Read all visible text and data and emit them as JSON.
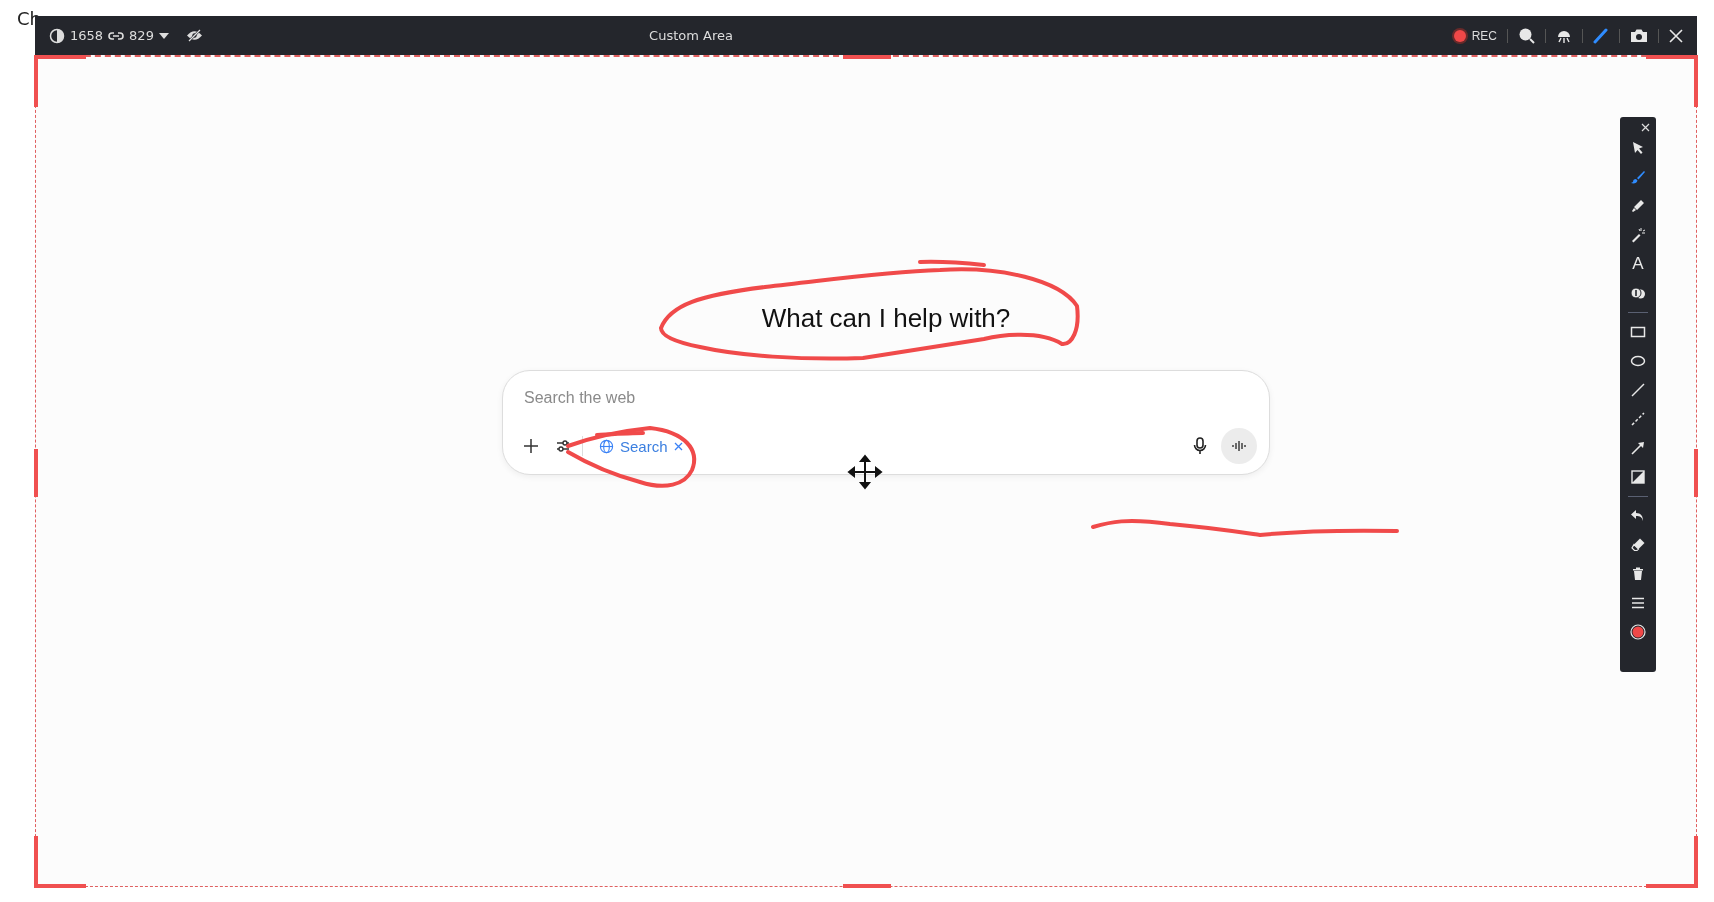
{
  "background_title": "Ch",
  "capture_bar": {
    "width_value": "1658",
    "height_value": "829",
    "title": "Custom Area",
    "rec_label": "REC",
    "tools": [
      {
        "kind": "magnifier",
        "selected": false
      },
      {
        "kind": "spotlight",
        "selected": false
      },
      {
        "kind": "pen",
        "selected": true
      },
      {
        "kind": "camera",
        "selected": false
      },
      {
        "kind": "close",
        "selected": false
      }
    ]
  },
  "heading": "What can I help with?",
  "composer": {
    "placeholder": "Search the web",
    "chip_label": "Search"
  },
  "side_toolbar": [
    {
      "kind": "pointer",
      "selected": false
    },
    {
      "kind": "brush",
      "selected": true
    },
    {
      "kind": "marker",
      "selected": false
    },
    {
      "kind": "magic",
      "selected": false
    },
    {
      "kind": "text",
      "label": "A",
      "selected": false
    },
    {
      "kind": "counter",
      "selected": false
    },
    {
      "kind": "divider"
    },
    {
      "kind": "rectangle",
      "selected": false
    },
    {
      "kind": "ellipse",
      "selected": false
    },
    {
      "kind": "line",
      "selected": false
    },
    {
      "kind": "dashed-line",
      "selected": false
    },
    {
      "kind": "arrow",
      "selected": false
    },
    {
      "kind": "mosaic",
      "selected": false
    },
    {
      "kind": "divider"
    },
    {
      "kind": "undo",
      "selected": false
    },
    {
      "kind": "eraser",
      "selected": false
    },
    {
      "kind": "trash",
      "selected": false
    },
    {
      "kind": "menu",
      "selected": false
    },
    {
      "kind": "record",
      "selected": false
    }
  ]
}
